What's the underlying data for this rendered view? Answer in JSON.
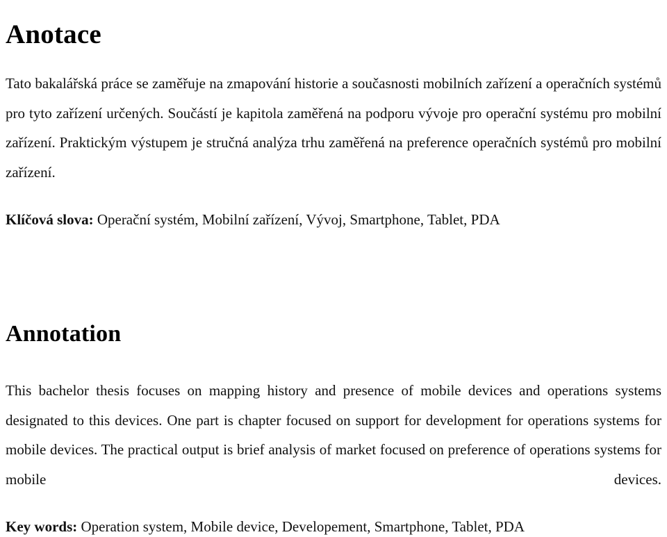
{
  "document": {
    "language_primary": "cs",
    "language_secondary": "en",
    "text_color": "#111111",
    "background_color": "#ffffff"
  },
  "czech_section": {
    "heading": "Anotace",
    "abstract": "Tato bakalářská práce se zaměřuje na zmapování historie a současnosti mobilních zařízení a operačních systémů pro tyto zařízení určených. Součástí je kapitola zaměřená na podporu vývoje pro operační systému pro mobilní zařízení. Praktickým výstupem je stručná analýza trhu zaměřená na preference operačních systémů pro mobilní zařízení.",
    "keywords_label": "Klíčová slova:",
    "keywords_value": "Operační systém, Mobilní zařízení, Vývoj, Smartphone, Tablet, PDA",
    "keywords_list": [
      "Operační systém",
      "Mobilní zařízení",
      "Vývoj",
      "Smartphone",
      "Tablet",
      "PDA"
    ]
  },
  "english_section": {
    "heading": "Annotation",
    "abstract": "This bachelor thesis focuses on mapping history and presence of mobile devices and operations systems designated to this devices. One part is chapter focused on support for development for operations systems for mobile devices. The practical output is brief analysis of market focused on preference of operations systems for mobile devices.",
    "keywords_label": "Key words:",
    "keywords_value": "Operation system, Mobile device, Developement, Smartphone, Tablet, PDA",
    "keywords_list": [
      "Operation system",
      "Mobile device",
      "Developement",
      "Smartphone",
      "Tablet",
      "PDA"
    ]
  }
}
